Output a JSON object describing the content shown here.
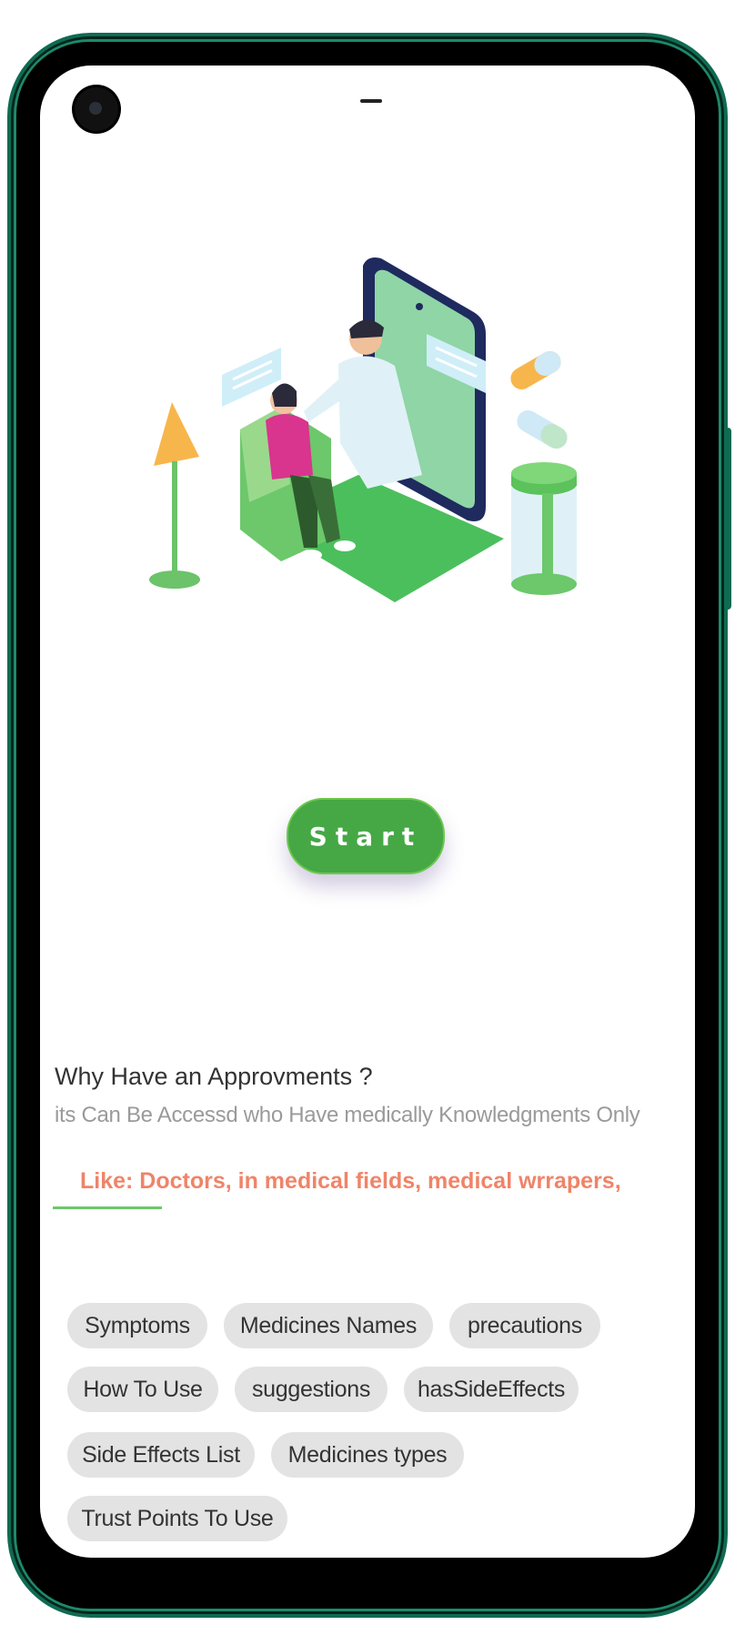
{
  "main": {
    "start_label": "Start",
    "why_title": "Why Have an Approvments ?",
    "why_description": "its Can Be Accessd who Have medically Knowledgments Only",
    "why_like": "Like: Doctors, in medical fields, medical wrrapers,"
  },
  "chips": [
    {
      "label": "Symptoms"
    },
    {
      "label": "Medicines Names"
    },
    {
      "label": "precautions"
    },
    {
      "label": "How To Use"
    },
    {
      "label": "suggestions"
    },
    {
      "label": "hasSideEffects"
    },
    {
      "label": "Side Effects List"
    },
    {
      "label": "Medicines types"
    },
    {
      "label": "Trust Points To Use"
    }
  ],
  "colors": {
    "accent": "#45a845",
    "highlight": "#ef8468",
    "chip_bg": "#e3e3e3",
    "phone_frame": "#0e6b52"
  },
  "icons": {
    "illustration": "doctor-patient-telemedicine-illustration",
    "camera": "front-camera-icon"
  }
}
